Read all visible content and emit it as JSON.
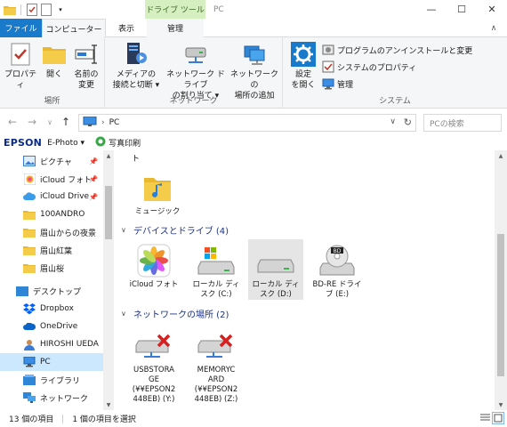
{
  "titlebar": {
    "context_tab": "ドライブ ツール",
    "window_title": "PC"
  },
  "tabs": {
    "file": "ファイル",
    "computer": "コンピューター",
    "view": "表示",
    "manage": "管理"
  },
  "ribbon": {
    "location": {
      "label": "場所",
      "properties": "プロパティ",
      "open": "開く",
      "rename_line1": "名前の",
      "rename_line2": "変更"
    },
    "network": {
      "label": "ネットワーク",
      "media_line1": "メディアの",
      "media_line2": "接続と切断 ▾",
      "map_line1": "ネットワーク ドライブ",
      "map_line2": "の割り当て ▾",
      "add_line1": "ネットワークの",
      "add_line2": "場所の追加"
    },
    "system": {
      "label": "システム",
      "settings_line1": "設定",
      "settings_line2": "を開く",
      "uninstall": "プログラムのアンインストールと変更",
      "sysprops": "システムのプロパティ",
      "manage": "管理"
    }
  },
  "address": {
    "path": "PC",
    "search_placeholder": "PCの検索"
  },
  "epson": {
    "logo": "EPSON",
    "product": "E-Photo ▾",
    "photo_print": "写真印刷"
  },
  "navpane": {
    "items": [
      {
        "label": "ピクチャ",
        "pinned": true
      },
      {
        "label": "iCloud フォト",
        "pinned": true
      },
      {
        "label": "iCloud Drive",
        "pinned": true
      },
      {
        "label": "100ANDRO",
        "pinned": false
      },
      {
        "label": "眉山からの夜景",
        "pinned": false
      },
      {
        "label": "眉山紅葉",
        "pinned": false
      },
      {
        "label": "眉山桜",
        "pinned": false
      },
      {
        "label": "デスクトップ",
        "pinned": false
      },
      {
        "label": "Dropbox",
        "pinned": false
      },
      {
        "label": "OneDrive",
        "pinned": false
      },
      {
        "label": "HIROSHI UEDA",
        "pinned": false
      },
      {
        "label": "PC",
        "pinned": false
      },
      {
        "label": "ライブラリ",
        "pinned": false
      },
      {
        "label": "ネットワーク",
        "pinned": false
      }
    ],
    "pin_glyph": "📌"
  },
  "content": {
    "cut_text": "ト",
    "music_label": "ミュージック",
    "devices_header": "デバイスとドライブ (4)",
    "devices": [
      {
        "label": "iCloud フォト"
      },
      {
        "label": "ローカル ディ\nスク (C:)"
      },
      {
        "label": "ローカル ディ\nスク (D:)"
      },
      {
        "label": "BD-RE ドライ\nブ (E:)"
      }
    ],
    "network_header": "ネットワークの場所 (2)",
    "network": [
      {
        "label": "USBSTORA\nGE\n(¥¥EPSON2\n448EB) (Y:)"
      },
      {
        "label": "MEMORYC\nARD\n(¥¥EPSON2\n448EB) (Z:)"
      }
    ]
  },
  "status": {
    "count": "13 個の項目",
    "selected": "1 個の項目を選択"
  },
  "colors": {
    "accent": "#1979ca",
    "context_tab": "#d6efc1",
    "selection": "#cce8ff",
    "group_header": "#1e3287"
  }
}
